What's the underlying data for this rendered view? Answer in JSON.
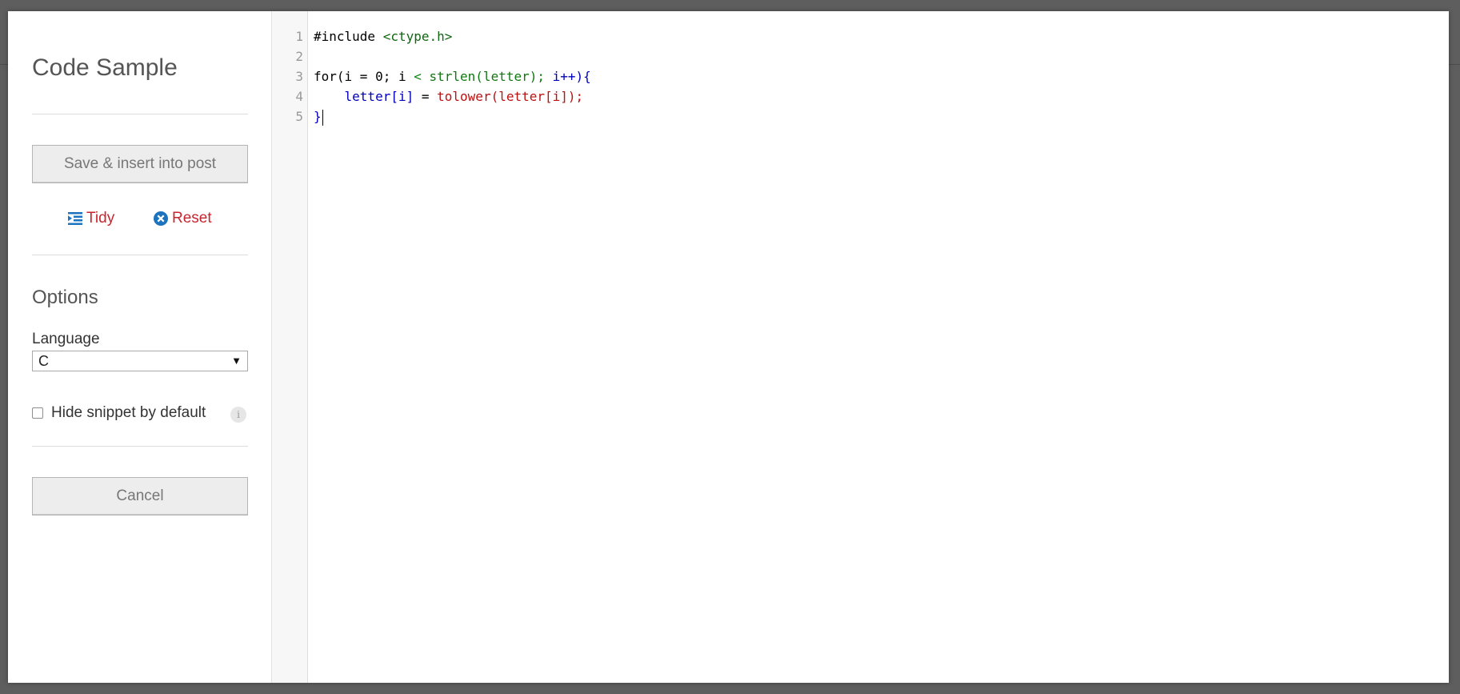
{
  "dialog": {
    "title": "Code Sample",
    "save_label": "Save & insert into post",
    "tidy_label": "Tidy",
    "reset_label": "Reset",
    "options_title": "Options",
    "language_label": "Language",
    "language_value": "C",
    "hide_snippet_label": "Hide snippet by default",
    "hide_snippet_checked": false,
    "cancel_label": "Cancel"
  },
  "editor": {
    "line_numbers": [
      "1",
      "2",
      "3",
      "4",
      "5"
    ],
    "lines": [
      [
        {
          "t": "#include ",
          "c": "plain"
        },
        {
          "t": "<ctype.h>",
          "c": "header"
        }
      ],
      [],
      [
        {
          "t": "for(i = 0; i ",
          "c": "plain"
        },
        {
          "t": "< ",
          "c": "op"
        },
        {
          "t": "strlen(letter); ",
          "c": "func"
        },
        {
          "t": "i++){",
          "c": "var"
        }
      ],
      [
        {
          "t": "    ",
          "c": "plain"
        },
        {
          "t": "letter[i]",
          "c": "var"
        },
        {
          "t": " = ",
          "c": "plain"
        },
        {
          "t": "tolower(letter[i]);",
          "c": "call"
        }
      ],
      [
        {
          "t": "}",
          "c": "var"
        }
      ]
    ],
    "cursor_line": 5
  },
  "colors": {
    "accent_link": "#c8262f",
    "icon_blue": "#1e73be",
    "token_header": "#116611",
    "token_var": "#0000bb",
    "token_call": "#bb1111"
  }
}
